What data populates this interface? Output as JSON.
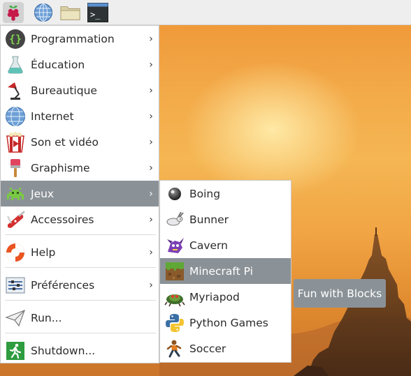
{
  "taskbar": {
    "icons": [
      {
        "name": "raspberry-menu-icon"
      },
      {
        "name": "web-browser-icon"
      },
      {
        "name": "file-manager-icon"
      },
      {
        "name": "terminal-icon",
        "glyph": ">_"
      }
    ]
  },
  "menu": {
    "items": [
      {
        "label": "Programmation",
        "icon": "code-braces-icon",
        "has_submenu": true
      },
      {
        "label": "Éducation",
        "icon": "flask-icon",
        "has_submenu": true
      },
      {
        "label": "Bureautique",
        "icon": "desk-lamp-icon",
        "has_submenu": true
      },
      {
        "label": "Internet",
        "icon": "globe-icon",
        "has_submenu": true
      },
      {
        "label": "Son et vidéo",
        "icon": "popcorn-video-icon",
        "has_submenu": true
      },
      {
        "label": "Graphisme",
        "icon": "paintbrush-icon",
        "has_submenu": true
      },
      {
        "label": "Jeux",
        "icon": "space-invader-icon",
        "has_submenu": true,
        "selected": true
      },
      {
        "label": "Accessoires",
        "icon": "swiss-knife-icon",
        "has_submenu": true
      },
      {
        "label": "Help",
        "icon": "lifebuoy-icon",
        "has_submenu": true
      },
      {
        "label": "Préférences",
        "icon": "preferences-sliders-icon",
        "has_submenu": true
      },
      {
        "label": "Run...",
        "icon": "paper-plane-icon",
        "has_submenu": false
      },
      {
        "label": "Shutdown...",
        "icon": "exit-running-man-icon",
        "has_submenu": false
      }
    ],
    "arrow": "›"
  },
  "submenu": {
    "items": [
      {
        "label": "Boing",
        "icon": "ball-icon"
      },
      {
        "label": "Bunner",
        "icon": "rabbit-icon"
      },
      {
        "label": "Cavern",
        "icon": "dragon-icon"
      },
      {
        "label": "Minecraft Pi",
        "icon": "minecraft-block-icon",
        "selected": true
      },
      {
        "label": "Myriapod",
        "icon": "centipede-icon"
      },
      {
        "label": "Python Games",
        "icon": "python-logo-icon"
      },
      {
        "label": "Soccer",
        "icon": "soccer-player-icon"
      }
    ]
  },
  "tooltip": {
    "text": "Fun with Blocks"
  },
  "colors": {
    "selection": "#8b9297",
    "taskbar": "#eeeeee",
    "menu_bg": "#ffffff"
  }
}
